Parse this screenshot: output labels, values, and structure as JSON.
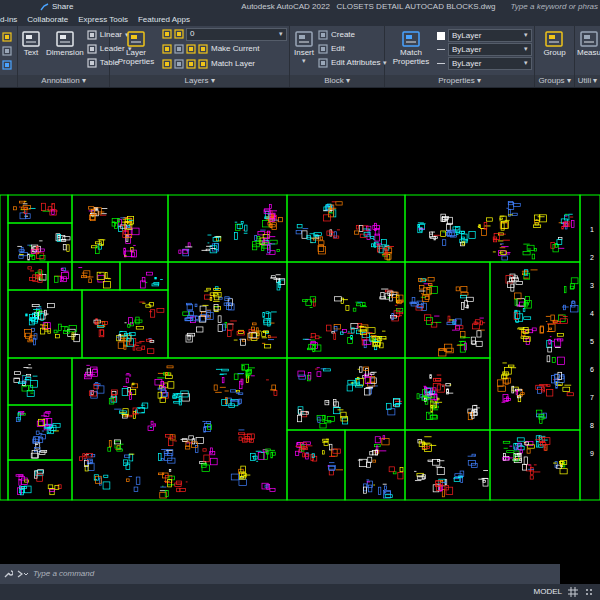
{
  "window": {
    "title": "Autodesk AutoCAD 2022   CLOSETS DETAIL AUTOCAD BLOCKS.dwg",
    "share": "Share"
  },
  "search": {
    "placeholder": "Type a keyword or phras"
  },
  "tabs": [
    {
      "label": "d-ins",
      "selected": false
    },
    {
      "label": "Collaborate",
      "selected": false
    },
    {
      "label": "Express Tools",
      "selected": false
    },
    {
      "label": "Featured Apps",
      "selected": false
    }
  ],
  "ribbon": {
    "dropdown_glyph": "▾",
    "annotation": {
      "label": "Annotation",
      "large": [
        "Text",
        "Dimension"
      ],
      "small": [
        {
          "label": "Linear",
          "dropdown": true
        },
        {
          "label": "Leader",
          "dropdown": true
        },
        {
          "label": "Table",
          "dropdown": false
        }
      ]
    },
    "layers": {
      "label": "Layers",
      "large": "Layer Properties",
      "current_layer": "0",
      "small": [
        "Make Current",
        "Match Layer"
      ]
    },
    "block": {
      "label": "Block",
      "large": "Insert",
      "small": [
        {
          "label": "Create",
          "dropdown": false
        },
        {
          "label": "Edit",
          "dropdown": false
        },
        {
          "label": "Edit Attributes",
          "dropdown": true
        }
      ]
    },
    "properties": {
      "label": "Properties",
      "large": "Match Properties",
      "combos": [
        "ByLayer",
        "ByLayer",
        "ByLayer"
      ]
    },
    "groups": {
      "label": "Groups",
      "large": "Group"
    },
    "utilities": {
      "label": "Utili",
      "large": "Measu"
    }
  },
  "canvas": {
    "row_numbers": [
      "1",
      "2",
      "3",
      "4",
      "5",
      "6",
      "7",
      "8",
      "9"
    ]
  },
  "command_line": {
    "placeholder": "Type a command"
  },
  "status_bar": {
    "mode": "MODEL"
  }
}
